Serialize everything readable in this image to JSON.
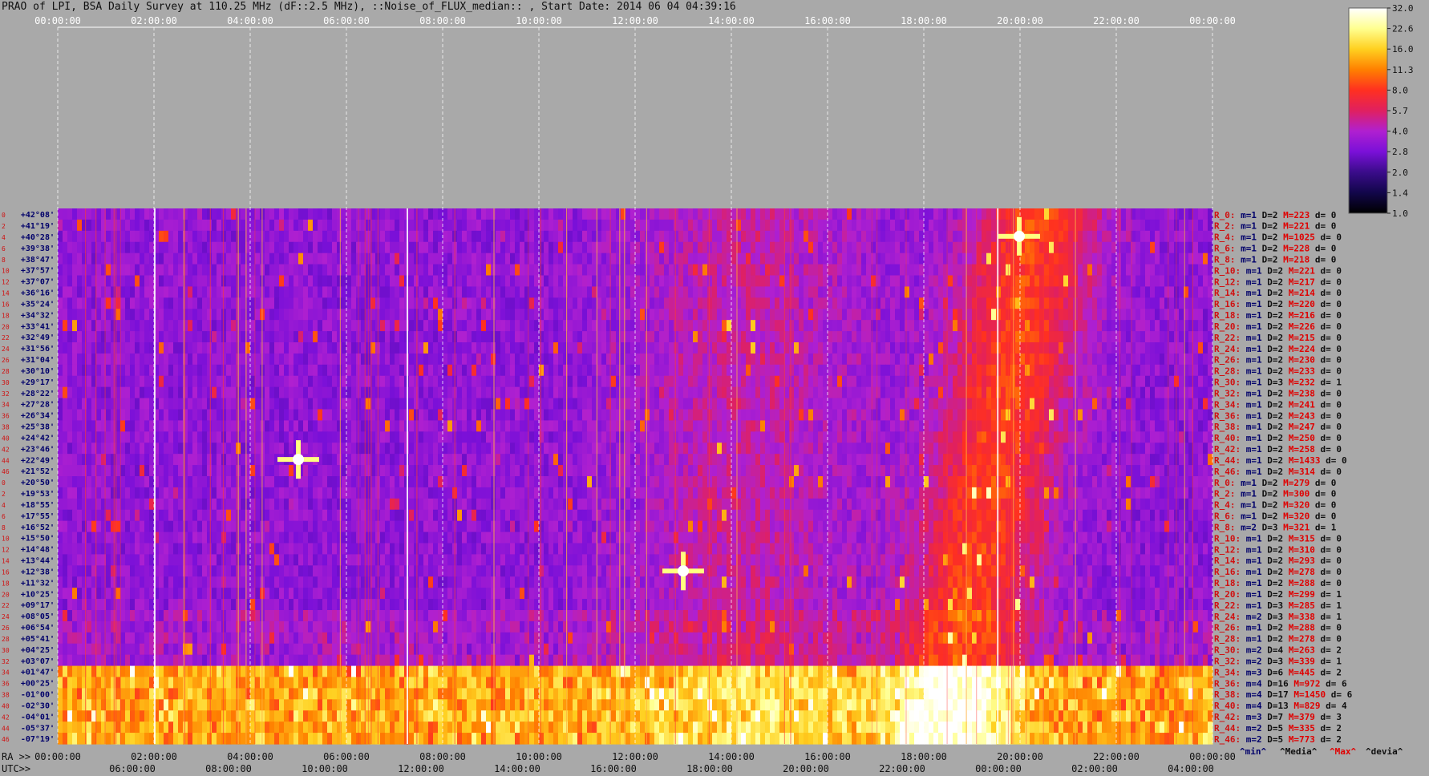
{
  "header": {
    "title": "PRAO of LPI, BSA Daily Survey at 110.25 MHz (dF::2.5 MHz), ::Noise_of_FLUX_median:: , Start Date: 2014 06 04 04:39:16"
  },
  "colorbar": {
    "ticks": [
      "32.0",
      "22.6",
      "16.0",
      "11.3",
      "8.0",
      "5.7",
      "4.0",
      "2.8",
      "2.0",
      "1.4",
      "1.0"
    ],
    "colors": [
      "#000000",
      "#12064a",
      "#3a0c8a",
      "#7a10d8",
      "#b020d0",
      "#e02060",
      "#ff3020",
      "#ff8000",
      "#ffd020",
      "#ffff90",
      "#ffffff"
    ],
    "scale": "log"
  },
  "chart_data": {
    "type": "heatmap",
    "title": "PRAO of LPI, BSA Daily Survey at 110.25 MHz (dF::2.5 MHz), ::Noise_of_FLUX_median:: , Start Date: 2014 06 04 04:39:16",
    "top_ticks": [
      "00:00:00",
      "02:00:00",
      "04:00:00",
      "06:00:00",
      "08:00:00",
      "10:00:00",
      "12:00:00",
      "14:00:00",
      "16:00:00",
      "18:00:00",
      "20:00:00",
      "22:00:00",
      "00:00:00"
    ],
    "ra_label": "RA >>",
    "ra_ticks": [
      "00:00:00",
      "02:00:00",
      "04:00:00",
      "06:00:00",
      "08:00:00",
      "10:00:00",
      "12:00:00",
      "14:00:00",
      "16:00:00",
      "18:00:00",
      "20:00:00",
      "22:00:00",
      "00:00:00"
    ],
    "utc_label": "UTC>>",
    "utc_ticks": [
      "06:00:00",
      "08:00:00",
      "10:00:00",
      "12:00:00",
      "14:00:00",
      "16:00:00",
      "18:00:00",
      "20:00:00",
      "22:00:00",
      "00:00:00",
      "02:00:00",
      "04:00:00"
    ],
    "declinations": [
      "+42°08'",
      "+41°19'",
      "+40°28'",
      "+39°38'",
      "+38°47'",
      "+37°57'",
      "+37°07'",
      "+36°16'",
      "+35°24'",
      "+34°32'",
      "+33°41'",
      "+32°49'",
      "+31°56'",
      "+31°04'",
      "+30°10'",
      "+29°17'",
      "+28°22'",
      "+27°28'",
      "+26°34'",
      "+25°38'",
      "+24°42'",
      "+23°46'",
      "+22°49'",
      "+21°52'",
      "+20°50'",
      "+19°53'",
      "+18°55'",
      "+17°55'",
      "+16°52'",
      "+15°50'",
      "+14°48'",
      "+13°44'",
      "+12°38'",
      "+11°32'",
      "+10°25'",
      "+09°17'",
      "+08°05'",
      "+06°54'",
      "+05°41'",
      "+04°25'",
      "+03°07'",
      "+01°47'",
      "+00°25'",
      "-01°00'",
      "-02°30'",
      "-04°01'",
      "-05°37'",
      "-07°19'"
    ],
    "row_indices": [
      "0",
      "2",
      "4",
      "6",
      "8",
      "10",
      "12",
      "14",
      "16",
      "18",
      "20",
      "22",
      "24",
      "26",
      "28",
      "30",
      "32",
      "34",
      "36",
      "38",
      "40",
      "42",
      "44",
      "46",
      "0",
      "2",
      "4",
      "6",
      "8",
      "10",
      "12",
      "14",
      "16",
      "18",
      "20",
      "22",
      "24",
      "26",
      "28",
      "30",
      "32",
      "34",
      "36",
      "38",
      "40",
      "42",
      "44",
      "46"
    ],
    "point_sources": [
      {
        "ra": "05:00:00",
        "dec": "+22°49'"
      },
      {
        "ra": "19:59:00",
        "dec": "+40°28'"
      },
      {
        "ra": "13:00:00",
        "dec": "+12°38'"
      }
    ]
  },
  "beam_stats": [
    {
      "label": "R_0:",
      "m": "m=1",
      "D": "D=2",
      "M": "M=223",
      "d": "d= 0"
    },
    {
      "label": "R_2:",
      "m": "m=1",
      "D": "D=2",
      "M": "M=221",
      "d": "d= 0"
    },
    {
      "label": "R_4:",
      "m": "m=1",
      "D": "D=2",
      "M": "M=1025",
      "d": "d= 0"
    },
    {
      "label": "R_6:",
      "m": "m=1",
      "D": "D=2",
      "M": "M=228",
      "d": "d= 0"
    },
    {
      "label": "R_8:",
      "m": "m=1",
      "D": "D=2",
      "M": "M=218",
      "d": "d= 0"
    },
    {
      "label": "R_10:",
      "m": "m=1",
      "D": "D=2",
      "M": "M=221",
      "d": "d= 0"
    },
    {
      "label": "R_12:",
      "m": "m=1",
      "D": "D=2",
      "M": "M=217",
      "d": "d= 0"
    },
    {
      "label": "R_14:",
      "m": "m=1",
      "D": "D=2",
      "M": "M=214",
      "d": "d= 0"
    },
    {
      "label": "R_16:",
      "m": "m=1",
      "D": "D=2",
      "M": "M=220",
      "d": "d= 0"
    },
    {
      "label": "R_18:",
      "m": "m=1",
      "D": "D=2",
      "M": "M=216",
      "d": "d= 0"
    },
    {
      "label": "R_20:",
      "m": "m=1",
      "D": "D=2",
      "M": "M=226",
      "d": "d= 0"
    },
    {
      "label": "R_22:",
      "m": "m=1",
      "D": "D=2",
      "M": "M=215",
      "d": "d= 0"
    },
    {
      "label": "R_24:",
      "m": "m=1",
      "D": "D=2",
      "M": "M=224",
      "d": "d= 0"
    },
    {
      "label": "R_26:",
      "m": "m=1",
      "D": "D=2",
      "M": "M=230",
      "d": "d= 0"
    },
    {
      "label": "R_28:",
      "m": "m=1",
      "D": "D=2",
      "M": "M=233",
      "d": "d= 0"
    },
    {
      "label": "R_30:",
      "m": "m=1",
      "D": "D=3",
      "M": "M=232",
      "d": "d= 1"
    },
    {
      "label": "R_32:",
      "m": "m=1",
      "D": "D=2",
      "M": "M=238",
      "d": "d= 0"
    },
    {
      "label": "R_34:",
      "m": "m=1",
      "D": "D=2",
      "M": "M=241",
      "d": "d= 0"
    },
    {
      "label": "R_36:",
      "m": "m=1",
      "D": "D=2",
      "M": "M=243",
      "d": "d= 0"
    },
    {
      "label": "R_38:",
      "m": "m=1",
      "D": "D=2",
      "M": "M=247",
      "d": "d= 0"
    },
    {
      "label": "R_40:",
      "m": "m=1",
      "D": "D=2",
      "M": "M=250",
      "d": "d= 0"
    },
    {
      "label": "R_42:",
      "m": "m=1",
      "D": "D=2",
      "M": "M=258",
      "d": "d= 0"
    },
    {
      "label": "R_44:",
      "m": "m=1",
      "D": "D=2",
      "M": "M=1433",
      "d": "d= 0"
    },
    {
      "label": "R_46:",
      "m": "m=1",
      "D": "D=2",
      "M": "M=314",
      "d": "d= 0"
    },
    {
      "label": "R_0:",
      "m": "m=1",
      "D": "D=2",
      "M": "M=279",
      "d": "d= 0"
    },
    {
      "label": "R_2:",
      "m": "m=1",
      "D": "D=2",
      "M": "M=300",
      "d": "d= 0"
    },
    {
      "label": "R_4:",
      "m": "m=1",
      "D": "D=2",
      "M": "M=320",
      "d": "d= 0"
    },
    {
      "label": "R_6:",
      "m": "m=1",
      "D": "D=2",
      "M": "M=320",
      "d": "d= 0"
    },
    {
      "label": "R_8:",
      "m": "m=2",
      "D": "D=3",
      "M": "M=321",
      "d": "d= 1"
    },
    {
      "label": "R_10:",
      "m": "m=1",
      "D": "D=2",
      "M": "M=315",
      "d": "d= 0"
    },
    {
      "label": "R_12:",
      "m": "m=1",
      "D": "D=2",
      "M": "M=310",
      "d": "d= 0"
    },
    {
      "label": "R_14:",
      "m": "m=1",
      "D": "D=2",
      "M": "M=293",
      "d": "d= 0"
    },
    {
      "label": "R_16:",
      "m": "m=1",
      "D": "D=2",
      "M": "M=278",
      "d": "d= 0"
    },
    {
      "label": "R_18:",
      "m": "m=1",
      "D": "D=2",
      "M": "M=288",
      "d": "d= 0"
    },
    {
      "label": "R_20:",
      "m": "m=1",
      "D": "D=2",
      "M": "M=299",
      "d": "d= 1"
    },
    {
      "label": "R_22:",
      "m": "m=1",
      "D": "D=3",
      "M": "M=285",
      "d": "d= 1"
    },
    {
      "label": "R_24:",
      "m": "m=2",
      "D": "D=3",
      "M": "M=338",
      "d": "d= 1"
    },
    {
      "label": "R_26:",
      "m": "m=1",
      "D": "D=2",
      "M": "M=288",
      "d": "d= 0"
    },
    {
      "label": "R_28:",
      "m": "m=1",
      "D": "D=2",
      "M": "M=278",
      "d": "d= 0"
    },
    {
      "label": "R_30:",
      "m": "m=2",
      "D": "D=4",
      "M": "M=263",
      "d": "d= 2"
    },
    {
      "label": "R_32:",
      "m": "m=2",
      "D": "D=3",
      "M": "M=339",
      "d": "d= 1"
    },
    {
      "label": "R_34:",
      "m": "m=3",
      "D": "D=6",
      "M": "M=445",
      "d": "d= 2"
    },
    {
      "label": "R_36:",
      "m": "m=4",
      "D": "D=16",
      "M": "M=972",
      "d": "d= 6"
    },
    {
      "label": "R_38:",
      "m": "m=4",
      "D": "D=17",
      "M": "M=1450",
      "d": "d= 6"
    },
    {
      "label": "R_40:",
      "m": "m=4",
      "D": "D=13",
      "M": "M=829",
      "d": "d= 4"
    },
    {
      "label": "R_42:",
      "m": "m=3",
      "D": "D=7",
      "M": "M=379",
      "d": "d= 3"
    },
    {
      "label": "R_44:",
      "m": "m=2",
      "D": "D=5",
      "M": "M=335",
      "d": "d= 2"
    },
    {
      "label": "R_46:",
      "m": "m=2",
      "D": "D=5",
      "M": "M=773",
      "d": "d= 2"
    }
  ],
  "legend": {
    "min": "^min^",
    "median": "^Media^",
    "max": "^Max^",
    "dev": "^devia^",
    "colors": {
      "min": "#00006a",
      "median": "#101010",
      "max": "#e00000",
      "dev": "#101010"
    }
  }
}
